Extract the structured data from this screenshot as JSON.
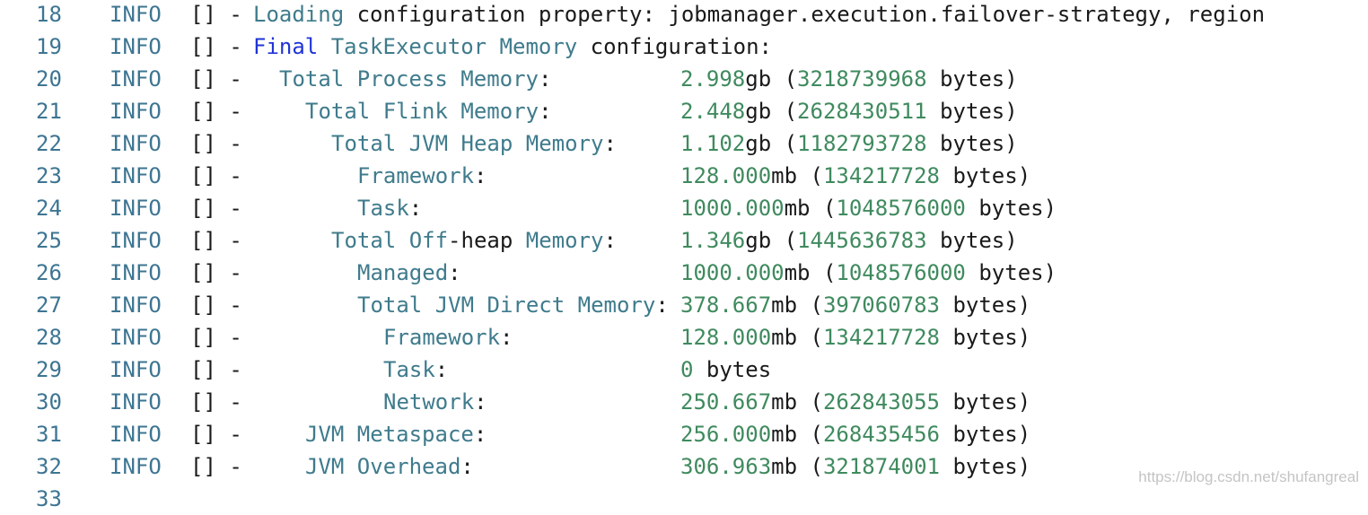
{
  "log": {
    "lines": [
      {
        "n": "18",
        "level": "INFO",
        "ctx": "[] -",
        "tokens": [
          {
            "t": "Loading",
            "c": "teal"
          },
          {
            "t": " configuration property: jobmanager.execution.failover-strategy, region",
            "c": "plain"
          }
        ]
      },
      {
        "n": "19",
        "level": "INFO",
        "ctx": "[] -",
        "tokens": [
          {
            "t": "Final",
            "c": "kw"
          },
          {
            "t": " TaskExecutor Memory",
            "c": "teal"
          },
          {
            "t": " configuration:",
            "c": "plain"
          }
        ]
      },
      {
        "n": "20",
        "level": "INFO",
        "ctx": "[] -",
        "indent": 1,
        "key": "Total Process Memory",
        "value": {
          "num": "2.998",
          "unit": "gb (",
          "bytes": "3218739968",
          "tail": " bytes)"
        }
      },
      {
        "n": "21",
        "level": "INFO",
        "ctx": "[] -",
        "indent": 2,
        "key": "Total Flink Memory",
        "value": {
          "num": "2.448",
          "unit": "gb (",
          "bytes": "2628430511",
          "tail": " bytes)"
        }
      },
      {
        "n": "22",
        "level": "INFO",
        "ctx": "[] -",
        "indent": 3,
        "key": "Total JVM Heap Memory",
        "value": {
          "num": "1.102",
          "unit": "gb (",
          "bytes": "1182793728",
          "tail": " bytes)"
        }
      },
      {
        "n": "23",
        "level": "INFO",
        "ctx": "[] -",
        "indent": 4,
        "key": "Framework",
        "value": {
          "num": "128.000",
          "unit": "mb (",
          "bytes": "134217728",
          "tail": " bytes)"
        }
      },
      {
        "n": "24",
        "level": "INFO",
        "ctx": "[] -",
        "indent": 4,
        "key": "Task",
        "value": {
          "num": "1000.000",
          "unit": "mb (",
          "bytes": "1048576000",
          "tail": " bytes)"
        }
      },
      {
        "n": "25",
        "level": "INFO",
        "ctx": "[] -",
        "indent": 3,
        "keyParts": [
          {
            "t": "Total Off",
            "c": "teal"
          },
          {
            "t": "-heap ",
            "c": "plain"
          },
          {
            "t": "Memory",
            "c": "teal"
          }
        ],
        "value": {
          "num": "1.346",
          "unit": "gb (",
          "bytes": "1445636783",
          "tail": " bytes)"
        }
      },
      {
        "n": "26",
        "level": "INFO",
        "ctx": "[] -",
        "indent": 4,
        "key": "Managed",
        "value": {
          "num": "1000.000",
          "unit": "mb (",
          "bytes": "1048576000",
          "tail": " bytes)"
        }
      },
      {
        "n": "27",
        "level": "INFO",
        "ctx": "[] -",
        "indent": 4,
        "key": "Total JVM Direct Memory",
        "value": {
          "num": "378.667",
          "unit": "mb (",
          "bytes": "397060783",
          "tail": " bytes)"
        }
      },
      {
        "n": "28",
        "level": "INFO",
        "ctx": "[] -",
        "indent": 5,
        "key": "Framework",
        "value": {
          "num": "128.000",
          "unit": "mb (",
          "bytes": "134217728",
          "tail": " bytes)"
        }
      },
      {
        "n": "29",
        "level": "INFO",
        "ctx": "[] -",
        "indent": 5,
        "key": "Task",
        "value": {
          "num": "0",
          "unit": " bytes",
          "bytes": "",
          "tail": ""
        }
      },
      {
        "n": "30",
        "level": "INFO",
        "ctx": "[] -",
        "indent": 5,
        "key": "Network",
        "value": {
          "num": "250.667",
          "unit": "mb (",
          "bytes": "262843055",
          "tail": " bytes)"
        }
      },
      {
        "n": "31",
        "level": "INFO",
        "ctx": "[] -",
        "indent": 2,
        "key": "JVM Metaspace",
        "value": {
          "num": "256.000",
          "unit": "mb (",
          "bytes": "268435456",
          "tail": " bytes)"
        }
      },
      {
        "n": "32",
        "level": "INFO",
        "ctx": "[] -",
        "indent": 2,
        "key": "JVM Overhead",
        "value": {
          "num": "306.963",
          "unit": "mb (",
          "bytes": "321874001",
          "tail": " bytes)"
        }
      },
      {
        "n": "33",
        "level": "",
        "ctx": "",
        "tokens": []
      }
    ]
  },
  "watermark": "https://blog.csdn.net/shufangreal"
}
